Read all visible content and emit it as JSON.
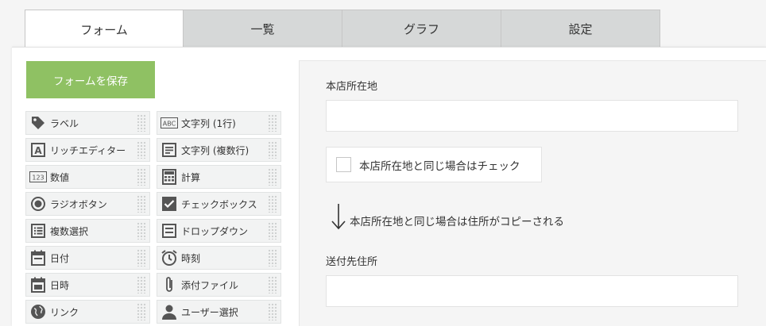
{
  "tabs": [
    {
      "label": "フォーム",
      "active": true
    },
    {
      "label": "一覧",
      "active": false
    },
    {
      "label": "グラフ",
      "active": false
    },
    {
      "label": "設定",
      "active": false
    }
  ],
  "save_button": "フォームを保存",
  "palette": [
    {
      "label": "ラベル",
      "icon": "tag-icon"
    },
    {
      "label": "文字列 (1行)",
      "icon": "abc-text-icon"
    },
    {
      "label": "リッチエディター",
      "icon": "rich-editor-icon"
    },
    {
      "label": "文字列 (複数行)",
      "icon": "multiline-text-icon"
    },
    {
      "label": "数値",
      "icon": "number-icon"
    },
    {
      "label": "計算",
      "icon": "calculator-icon"
    },
    {
      "label": "ラジオボタン",
      "icon": "radio-icon"
    },
    {
      "label": "チェックボックス",
      "icon": "checkbox-icon"
    },
    {
      "label": "複数選択",
      "icon": "multi-select-icon"
    },
    {
      "label": "ドロップダウン",
      "icon": "dropdown-icon"
    },
    {
      "label": "日付",
      "icon": "date-icon"
    },
    {
      "label": "時刻",
      "icon": "clock-icon"
    },
    {
      "label": "日時",
      "icon": "datetime-icon"
    },
    {
      "label": "添付ファイル",
      "icon": "paperclip-icon"
    },
    {
      "label": "リンク",
      "icon": "globe-icon"
    },
    {
      "label": "ユーザー選択",
      "icon": "user-icon"
    }
  ],
  "form": {
    "field1_label": "本店所在地",
    "field1_value": "",
    "checkbox_label": "本店所在地と同じ場合はチェック",
    "checkbox_checked": false,
    "note": "本店所在地と同じ場合は住所がコピーされる",
    "field2_label": "送付先住所",
    "field2_value": ""
  },
  "colors": {
    "save_button": "#8fc163",
    "tab_inactive": "#d6d8d8",
    "icon": "#555555"
  }
}
